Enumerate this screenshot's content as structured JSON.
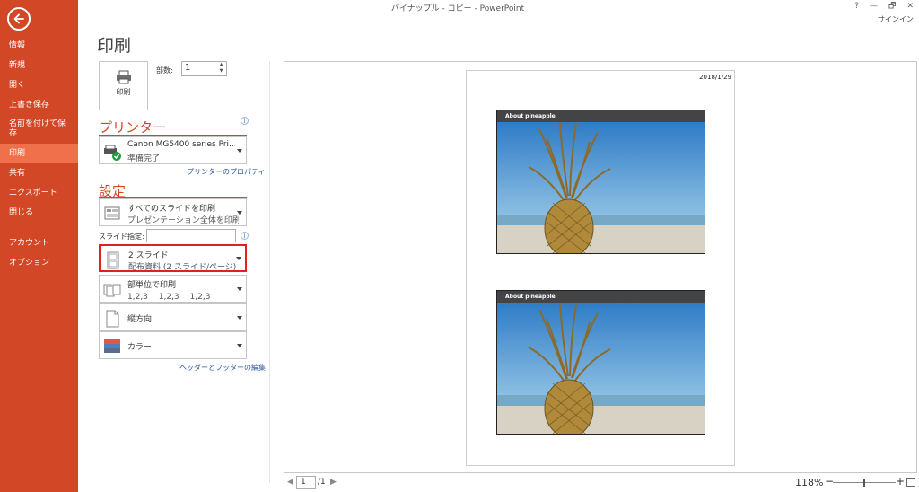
{
  "window": {
    "title": "パイナップル - コピー - PowerPoint",
    "help": "?",
    "minimize": "—",
    "restore": "🗗",
    "close": "✕",
    "signin": "サインイン"
  },
  "nav": {
    "items": [
      {
        "label": "情報"
      },
      {
        "label": "新規"
      },
      {
        "label": "開く"
      },
      {
        "label": "上書き保存"
      },
      {
        "label": "名前を付けて保存"
      },
      {
        "label": "印刷",
        "active": true
      },
      {
        "label": "共有"
      },
      {
        "label": "エクスポート"
      },
      {
        "label": "閉じる"
      },
      {
        "label": "アカウント"
      },
      {
        "label": "オプション"
      }
    ]
  },
  "print": {
    "page_title": "印刷",
    "button_label": "印刷",
    "copies_label": "部数:",
    "copies_value": "1",
    "printer_heading": "プリンター",
    "printer_name": "Canon MG5400 series Pri...",
    "printer_status": "準備完了",
    "printer_props_link": "プリンターのプロパティ",
    "settings_heading": "設定",
    "slides_range_l1": "すべてのスライドを印刷",
    "slides_range_l2": "プレゼンテーション全体を印刷し...",
    "slide_spec_label": "スライド指定:",
    "slide_spec_value": "",
    "layout_l1": "2 スライド",
    "layout_l2": "配布資料 (2 スライド/ページ)",
    "collate_l1": "部単位で印刷",
    "collate_l2": "1,2,3　 1,2,3　 1,2,3",
    "orientation": "縦方向",
    "color": "カラー",
    "header_footer_link": "ヘッダーとフッターの編集",
    "info_glyph": "i"
  },
  "preview": {
    "date": "2018/1/29",
    "slides": [
      {
        "title": "About  pineapple"
      },
      {
        "title": "About  pineapple"
      }
    ]
  },
  "status": {
    "prev": "◀",
    "next": "▶",
    "page_value": "1",
    "page_total": "/1",
    "zoom": "118%",
    "zoom_minus": "−",
    "zoom_plus": "+"
  },
  "colors": {
    "accent": "#d24726",
    "nav_active": "#f0704b",
    "highlight": "#e0211c",
    "link": "#2b579a"
  }
}
